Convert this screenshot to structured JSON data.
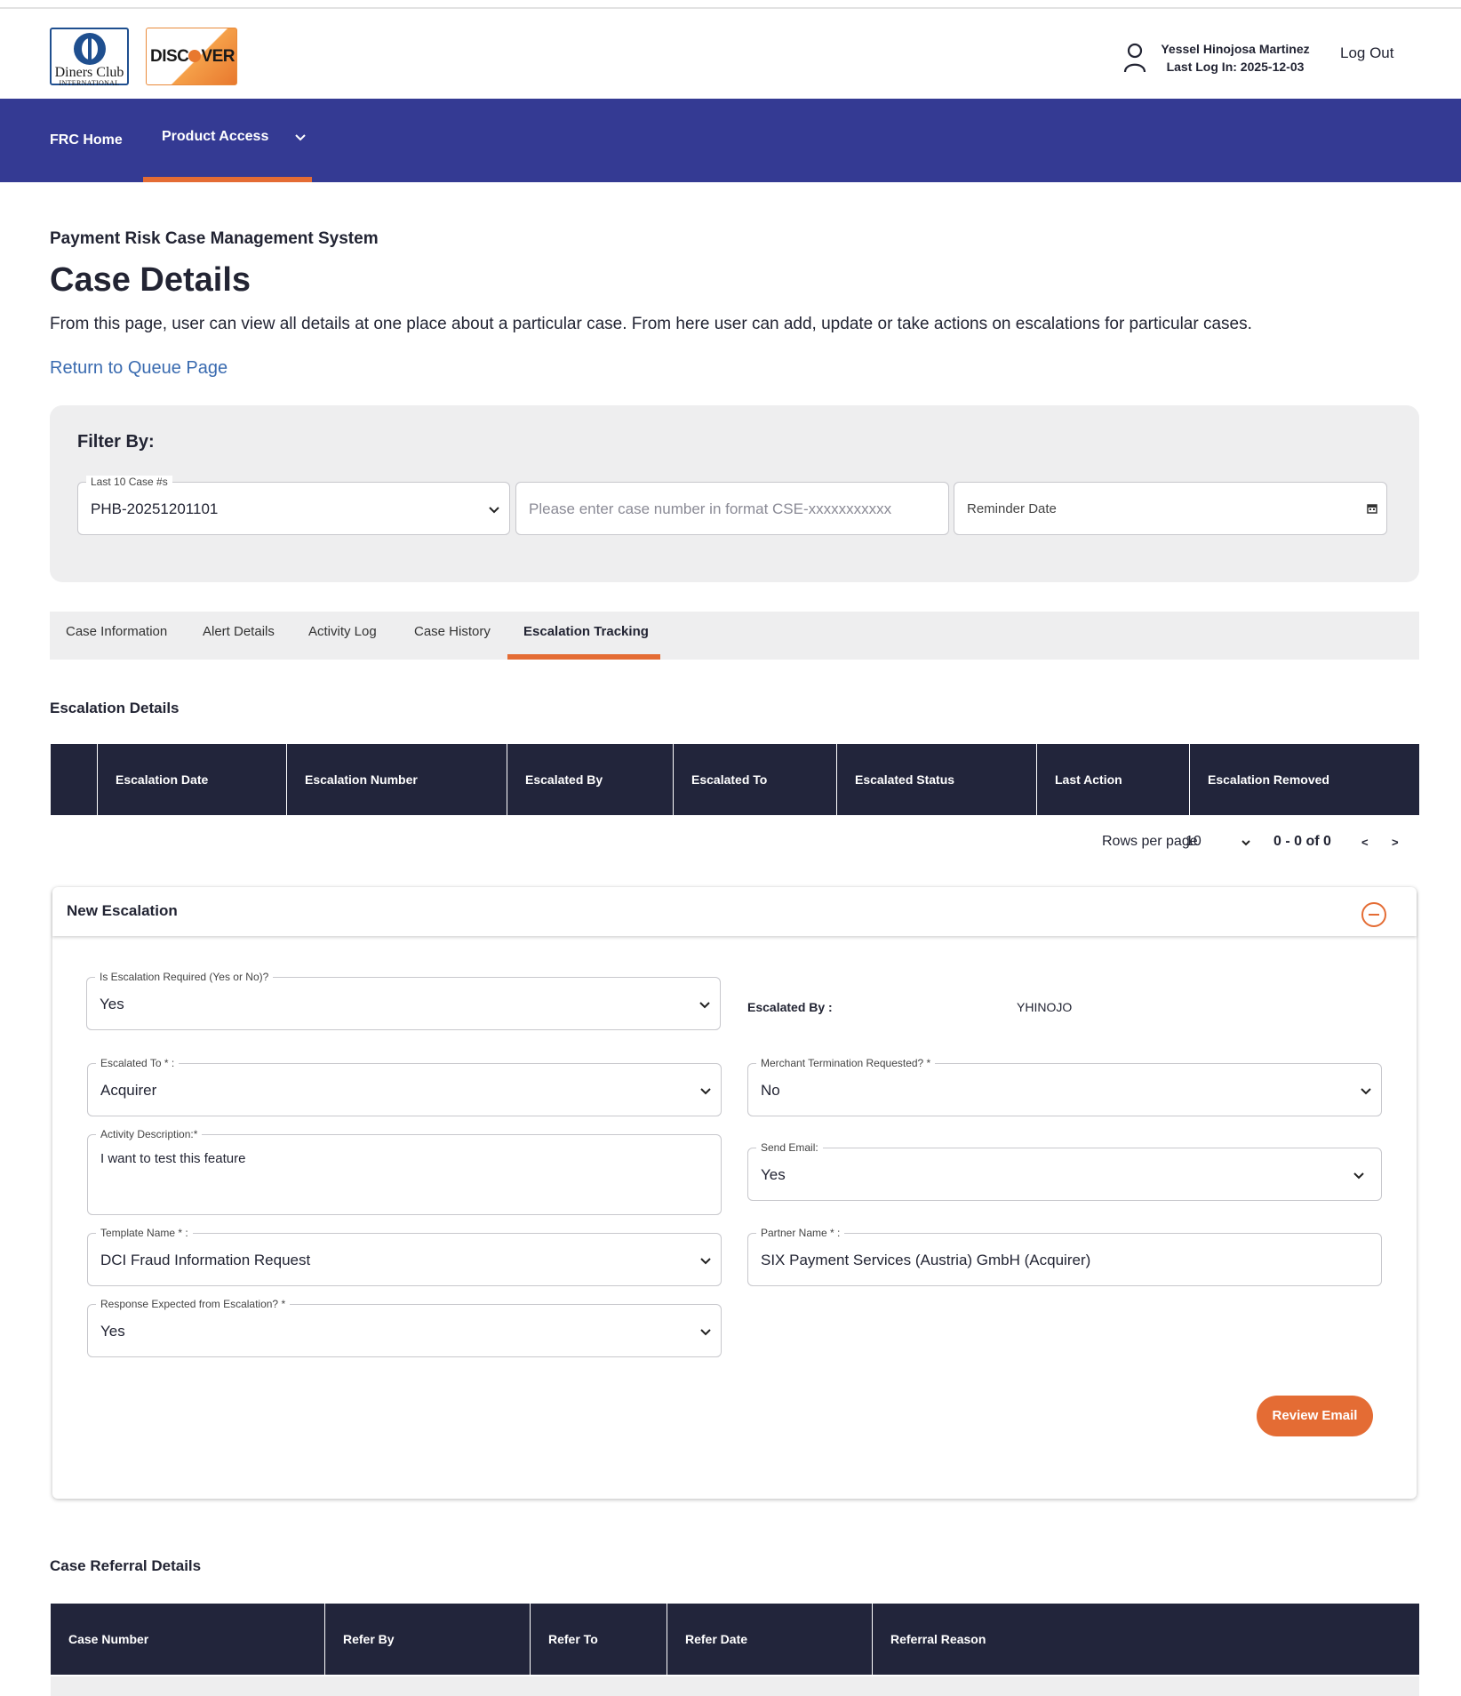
{
  "header": {
    "diners_logo": {
      "line1": "Diners Club",
      "line2": "INTERNATIONAL"
    },
    "discover_logo": {
      "left": "DISC",
      "right": "VER"
    },
    "user": {
      "name": "Yessel Hinojosa Martinez",
      "last_login": "Last Log In: 2025-12-03"
    },
    "logout_label": "Log Out"
  },
  "nav": {
    "home": "FRC Home",
    "product_access": "Product Access"
  },
  "page": {
    "system_title": "Payment Risk Case Management System",
    "title": "Case Details",
    "description": "From this page, user can view all details at one place about a particular case. From here user can add, update or take actions on escalations for particular cases.",
    "return_link": "Return to Queue Page"
  },
  "filter": {
    "title": "Filter By:",
    "last_cases": {
      "label": "Last 10 Case #s",
      "value": "PHB-20251201101"
    },
    "case_number": {
      "placeholder": "Please enter case number in format CSE-xxxxxxxxxxx"
    },
    "reminder_date": {
      "placeholder": "Reminder Date"
    }
  },
  "tabs": [
    "Case Information",
    "Alert Details",
    "Activity Log",
    "Case History",
    "Escalation Tracking"
  ],
  "active_tab": "Escalation Tracking",
  "escalation_details": {
    "title": "Escalation Details",
    "columns": [
      "Escalation Date",
      "Escalation Number",
      "Escalated By",
      "Escalated To",
      "Escalated Status",
      "Last Action",
      "Escalation Removed"
    ],
    "rows": []
  },
  "pagination": {
    "rows_per_page_label": "Rows per page",
    "rows_per_page": "10",
    "range": "0 - 0 of 0",
    "prev": "<",
    "next": ">"
  },
  "new_escalation": {
    "title": "New Escalation",
    "escalation_required": {
      "label": "Is Escalation Required (Yes or No)?",
      "value": "Yes"
    },
    "escalated_by": {
      "label": "Escalated By :",
      "value": "YHINOJO"
    },
    "escalated_to": {
      "label": "Escalated To * :",
      "value": "Acquirer"
    },
    "merchant_termination": {
      "label": "Merchant Termination Requested? *",
      "value": "No"
    },
    "activity_description": {
      "label": "Activity Description:*",
      "value": "I want to test this feature"
    },
    "send_email": {
      "label": "Send Email:",
      "value": "Yes"
    },
    "template_name": {
      "label": "Template Name * :",
      "value": "DCI Fraud Information Request"
    },
    "partner_name": {
      "label": "Partner Name * :",
      "value": "SIX Payment Services (Austria) GmbH (Acquirer)"
    },
    "response_expected": {
      "label": "Response Expected from Escalation? *",
      "value": "Yes"
    },
    "review_button": "Review Email"
  },
  "case_referral": {
    "title": "Case Referral Details",
    "columns": [
      "Case Number",
      "Refer By",
      "Refer To",
      "Refer Date",
      "Referral Reason"
    ]
  },
  "colors": {
    "nav": "#343a93",
    "accent": "#e46c34",
    "table_header": "#22253b",
    "link": "#3a6bb0",
    "panel": "#eeeeef"
  }
}
